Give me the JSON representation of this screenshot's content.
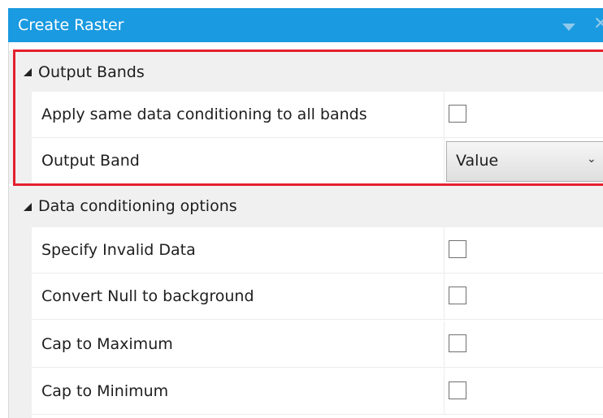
{
  "window": {
    "title": "Create Raster"
  },
  "categories": {
    "output_bands": {
      "label": "Output Bands",
      "rows": {
        "apply_same": {
          "label": "Apply same data conditioning to all bands",
          "checked": false
        },
        "output_band": {
          "label": "Output Band",
          "value": "Value"
        }
      }
    },
    "data_conditioning": {
      "label": "Data conditioning options",
      "rows": {
        "invalid_data": {
          "label": "Specify Invalid Data",
          "checked": false
        },
        "null_to_bg": {
          "label": "Convert Null to background",
          "checked": false
        },
        "cap_max": {
          "label": "Cap to Maximum",
          "checked": false
        },
        "cap_min": {
          "label": "Cap to Minimum",
          "checked": false
        }
      }
    }
  },
  "icons": {
    "collapse": "collapse-triangle-icon",
    "dropdown": "chevron-down-icon",
    "panel_menu": "panel-menu-arrow-icon",
    "close": "close-icon"
  },
  "colors": {
    "titlebar": "#1a9ae0",
    "highlight": "#e5202e"
  }
}
